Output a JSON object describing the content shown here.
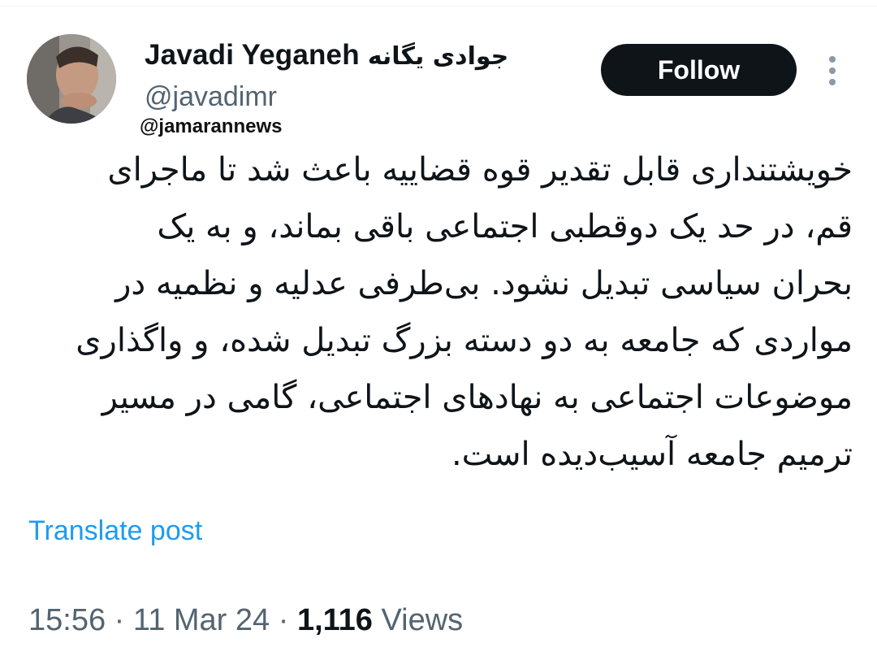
{
  "author": {
    "display_name": "Javadi Yeganeh",
    "display_name_fa": "جوادی یگانه",
    "handle": "@javadimr",
    "avatar_icon": "avatar-photo"
  },
  "watermark": "@jamarannews",
  "actions": {
    "follow_label": "Follow",
    "more_icon": "vertical-ellipsis-icon"
  },
  "tweet": {
    "lines": [
      "خویشتنداری قابل تقدیر قوه قضاییه باعث شد تا ماجرای",
      "قم، در حد یک دوقطبی اجتماعی باقی بماند، و به یک",
      "بحران سیاسی تبدیل نشود. بی‌طرفی عدلیه و نظمیه در",
      "مواردی که جامعه به دو دسته بزرگ تبدیل شده، و واگذاری",
      "موضوعات اجتماعی به نهادهای اجتماعی، گامی در مسیر",
      "ترمیم جامعه آسیب‌دیده است."
    ],
    "translate_label": "Translate post"
  },
  "meta": {
    "time": "15:56",
    "date": "11 Mar 24",
    "separator": "·",
    "views_count": "1,116",
    "views_label": "Views"
  },
  "colors": {
    "text": "#0f1419",
    "secondary": "#536471",
    "link": "#1d9bf0",
    "button_bg": "#0f1419"
  }
}
